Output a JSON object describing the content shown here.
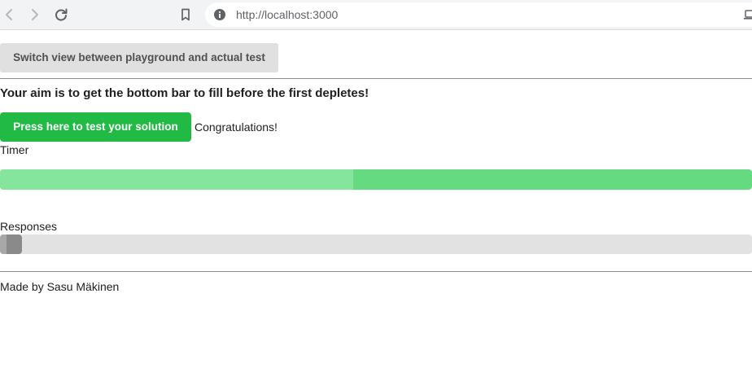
{
  "browser": {
    "url": "http://localhost:3000",
    "icons": {
      "back": "arrow-left-icon",
      "forward": "arrow-right-icon",
      "reload": "reload-icon",
      "bookmark": "bookmark-icon",
      "site_info": "info-icon",
      "device": "laptop-icon"
    }
  },
  "page": {
    "switch_button_label": "Switch view between playground and actual test",
    "aim_text": "Your aim is to get the bottom bar to fill before the first depletes!",
    "test_button_label": "Press here to test your solution",
    "status_text": "Congratulations!",
    "timer": {
      "label": "Timer",
      "percent": 47
    },
    "responses": {
      "label": "Responses",
      "percent": 0
    },
    "footer_text": "Made by Sasu Mäkinen"
  },
  "colors": {
    "test_button": "#21ba45",
    "timer_remaining": "#66da81",
    "timer_elapsed": "#86e59c",
    "responses_track": "#e2e2e2",
    "responses_fill": "#8a8a8a"
  }
}
